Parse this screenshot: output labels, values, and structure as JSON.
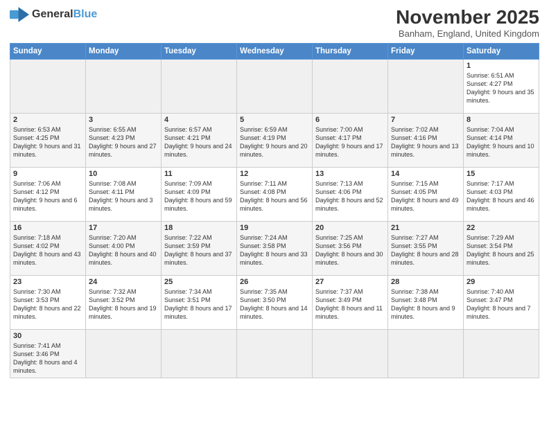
{
  "logo": {
    "text_general": "General",
    "text_blue": "Blue"
  },
  "header": {
    "month_title": "November 2025",
    "location": "Banham, England, United Kingdom"
  },
  "days_of_week": [
    "Sunday",
    "Monday",
    "Tuesday",
    "Wednesday",
    "Thursday",
    "Friday",
    "Saturday"
  ],
  "weeks": [
    [
      {
        "day": "",
        "info": ""
      },
      {
        "day": "",
        "info": ""
      },
      {
        "day": "",
        "info": ""
      },
      {
        "day": "",
        "info": ""
      },
      {
        "day": "",
        "info": ""
      },
      {
        "day": "",
        "info": ""
      },
      {
        "day": "1",
        "info": "Sunrise: 6:51 AM\nSunset: 4:27 PM\nDaylight: 9 hours\nand 35 minutes."
      }
    ],
    [
      {
        "day": "2",
        "info": "Sunrise: 6:53 AM\nSunset: 4:25 PM\nDaylight: 9 hours\nand 31 minutes."
      },
      {
        "day": "3",
        "info": "Sunrise: 6:55 AM\nSunset: 4:23 PM\nDaylight: 9 hours\nand 27 minutes."
      },
      {
        "day": "4",
        "info": "Sunrise: 6:57 AM\nSunset: 4:21 PM\nDaylight: 9 hours\nand 24 minutes."
      },
      {
        "day": "5",
        "info": "Sunrise: 6:59 AM\nSunset: 4:19 PM\nDaylight: 9 hours\nand 20 minutes."
      },
      {
        "day": "6",
        "info": "Sunrise: 7:00 AM\nSunset: 4:17 PM\nDaylight: 9 hours\nand 17 minutes."
      },
      {
        "day": "7",
        "info": "Sunrise: 7:02 AM\nSunset: 4:16 PM\nDaylight: 9 hours\nand 13 minutes."
      },
      {
        "day": "8",
        "info": "Sunrise: 7:04 AM\nSunset: 4:14 PM\nDaylight: 9 hours\nand 10 minutes."
      }
    ],
    [
      {
        "day": "9",
        "info": "Sunrise: 7:06 AM\nSunset: 4:12 PM\nDaylight: 9 hours\nand 6 minutes."
      },
      {
        "day": "10",
        "info": "Sunrise: 7:08 AM\nSunset: 4:11 PM\nDaylight: 9 hours\nand 3 minutes."
      },
      {
        "day": "11",
        "info": "Sunrise: 7:09 AM\nSunset: 4:09 PM\nDaylight: 8 hours\nand 59 minutes."
      },
      {
        "day": "12",
        "info": "Sunrise: 7:11 AM\nSunset: 4:08 PM\nDaylight: 8 hours\nand 56 minutes."
      },
      {
        "day": "13",
        "info": "Sunrise: 7:13 AM\nSunset: 4:06 PM\nDaylight: 8 hours\nand 52 minutes."
      },
      {
        "day": "14",
        "info": "Sunrise: 7:15 AM\nSunset: 4:05 PM\nDaylight: 8 hours\nand 49 minutes."
      },
      {
        "day": "15",
        "info": "Sunrise: 7:17 AM\nSunset: 4:03 PM\nDaylight: 8 hours\nand 46 minutes."
      }
    ],
    [
      {
        "day": "16",
        "info": "Sunrise: 7:18 AM\nSunset: 4:02 PM\nDaylight: 8 hours\nand 43 minutes."
      },
      {
        "day": "17",
        "info": "Sunrise: 7:20 AM\nSunset: 4:00 PM\nDaylight: 8 hours\nand 40 minutes."
      },
      {
        "day": "18",
        "info": "Sunrise: 7:22 AM\nSunset: 3:59 PM\nDaylight: 8 hours\nand 37 minutes."
      },
      {
        "day": "19",
        "info": "Sunrise: 7:24 AM\nSunset: 3:58 PM\nDaylight: 8 hours\nand 33 minutes."
      },
      {
        "day": "20",
        "info": "Sunrise: 7:25 AM\nSunset: 3:56 PM\nDaylight: 8 hours\nand 30 minutes."
      },
      {
        "day": "21",
        "info": "Sunrise: 7:27 AM\nSunset: 3:55 PM\nDaylight: 8 hours\nand 28 minutes."
      },
      {
        "day": "22",
        "info": "Sunrise: 7:29 AM\nSunset: 3:54 PM\nDaylight: 8 hours\nand 25 minutes."
      }
    ],
    [
      {
        "day": "23",
        "info": "Sunrise: 7:30 AM\nSunset: 3:53 PM\nDaylight: 8 hours\nand 22 minutes."
      },
      {
        "day": "24",
        "info": "Sunrise: 7:32 AM\nSunset: 3:52 PM\nDaylight: 8 hours\nand 19 minutes."
      },
      {
        "day": "25",
        "info": "Sunrise: 7:34 AM\nSunset: 3:51 PM\nDaylight: 8 hours\nand 17 minutes."
      },
      {
        "day": "26",
        "info": "Sunrise: 7:35 AM\nSunset: 3:50 PM\nDaylight: 8 hours\nand 14 minutes."
      },
      {
        "day": "27",
        "info": "Sunrise: 7:37 AM\nSunset: 3:49 PM\nDaylight: 8 hours\nand 11 minutes."
      },
      {
        "day": "28",
        "info": "Sunrise: 7:38 AM\nSunset: 3:48 PM\nDaylight: 8 hours\nand 9 minutes."
      },
      {
        "day": "29",
        "info": "Sunrise: 7:40 AM\nSunset: 3:47 PM\nDaylight: 8 hours\nand 7 minutes."
      }
    ],
    [
      {
        "day": "30",
        "info": "Sunrise: 7:41 AM\nSunset: 3:46 PM\nDaylight: 8 hours\nand 4 minutes."
      },
      {
        "day": "",
        "info": ""
      },
      {
        "day": "",
        "info": ""
      },
      {
        "day": "",
        "info": ""
      },
      {
        "day": "",
        "info": ""
      },
      {
        "day": "",
        "info": ""
      },
      {
        "day": "",
        "info": ""
      }
    ]
  ]
}
